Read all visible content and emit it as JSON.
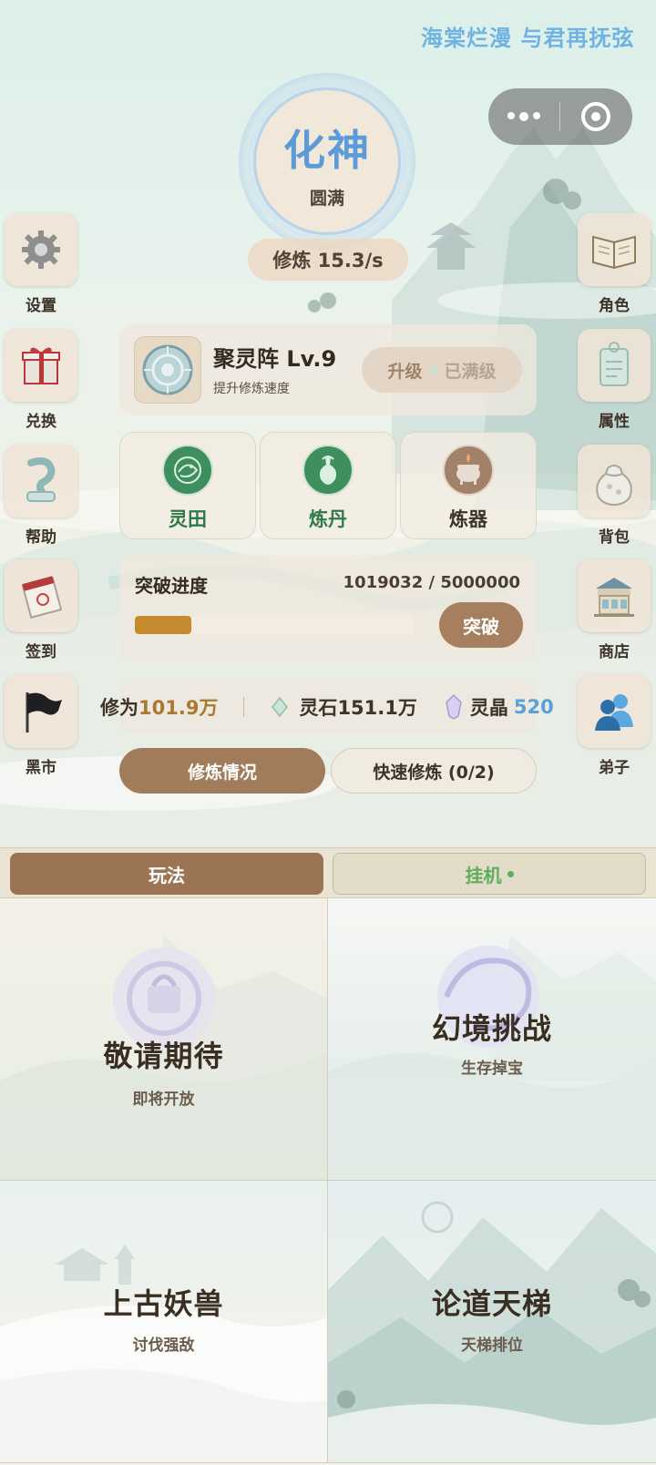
{
  "marquee_text": "海棠烂漫 与君再抚弦",
  "capsule": {
    "more_icon": "more-dots-icon",
    "close_icon": "target-close-icon"
  },
  "realm": {
    "name": "化神",
    "stage": "圆满"
  },
  "cultivation_rate": "修炼 15.3/s",
  "left_menu": [
    {
      "label": "设置",
      "icon": "gear-icon"
    },
    {
      "label": "兑换",
      "icon": "gift-box-icon"
    },
    {
      "label": "帮助",
      "icon": "scroll-help-icon"
    },
    {
      "label": "签到",
      "icon": "calendar-icon"
    },
    {
      "label": "黑市",
      "icon": "black-flag-icon"
    }
  ],
  "right_menu": [
    {
      "label": "角色",
      "icon": "book-icon"
    },
    {
      "label": "属性",
      "icon": "tag-icon"
    },
    {
      "label": "背包",
      "icon": "pouch-icon"
    },
    {
      "label": "商店",
      "icon": "shop-icon"
    },
    {
      "label": "弟子",
      "icon": "disciples-icon"
    }
  ],
  "formation": {
    "title": "聚灵阵 Lv.9",
    "subtitle": "提升修炼速度",
    "upgrade_label": "升级",
    "max_label": "已满级",
    "icon": "formation-disc-icon"
  },
  "features": [
    {
      "label": "灵田",
      "icon": "spirit-field-icon",
      "color": "#2f7a48"
    },
    {
      "label": "炼丹",
      "icon": "alchemy-vase-icon",
      "color": "#2f7a48"
    },
    {
      "label": "炼器",
      "icon": "forge-cauldron-icon",
      "color": "#3d3329"
    }
  ],
  "breakthrough": {
    "title": "突破进度",
    "current": 1019032,
    "target": 5000000,
    "progress_text": "1019032 / 5000000",
    "progress_fraction": 0.2038,
    "button": "突破"
  },
  "resources": {
    "cultivation_label": "修为",
    "cultivation_value": "101.9万",
    "stone_label": "灵石",
    "stone_value": "151.1万",
    "crystal_label": "灵晶",
    "crystal_value": "520"
  },
  "mode_buttons": {
    "status": "修炼情况",
    "quick": "快速修炼 (0/2)"
  },
  "tabs": {
    "play": "玩法",
    "idle": "挂机"
  },
  "modes": [
    {
      "title": "敬请期待",
      "subtitle": "即将开放"
    },
    {
      "title": "幻境挑战",
      "subtitle": "生存掉宝"
    },
    {
      "title": "上古妖兽",
      "subtitle": "讨伐强敌"
    },
    {
      "title": "论道天梯",
      "subtitle": "天梯排位"
    }
  ]
}
